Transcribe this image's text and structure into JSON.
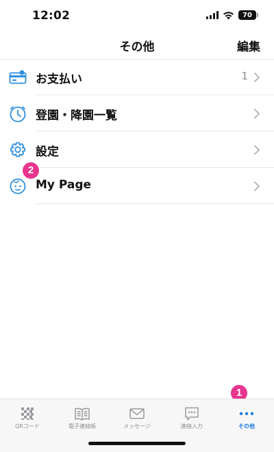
{
  "status_bar": {
    "time": "12:02",
    "battery": "70"
  },
  "nav": {
    "title": "その他",
    "edit_label": "編集"
  },
  "menu": {
    "items": [
      {
        "label": "お支払い",
        "count": "1",
        "icon": "payment-card-icon"
      },
      {
        "label": "登園・降園一覧",
        "icon": "clock-icon"
      },
      {
        "label": "設定",
        "icon": "gear-icon"
      },
      {
        "label": "My Page",
        "icon": "face-icon"
      }
    ]
  },
  "badges": {
    "one": "1",
    "two": "2"
  },
  "tabs": [
    {
      "label": "QRコード",
      "icon": "qr-code-icon",
      "active": false
    },
    {
      "label": "電子連絡帳",
      "icon": "book-icon",
      "active": false
    },
    {
      "label": "メッセージ",
      "icon": "envelope-icon",
      "active": false
    },
    {
      "label": "連絡入力",
      "icon": "chat-bubble-icon",
      "active": false
    },
    {
      "label": "その他",
      "icon": "more-dots-icon",
      "active": true
    }
  ],
  "colors": {
    "accent": "#1a7be3",
    "badge": "#e8368f",
    "icon_blue": "#2f8fe0"
  }
}
